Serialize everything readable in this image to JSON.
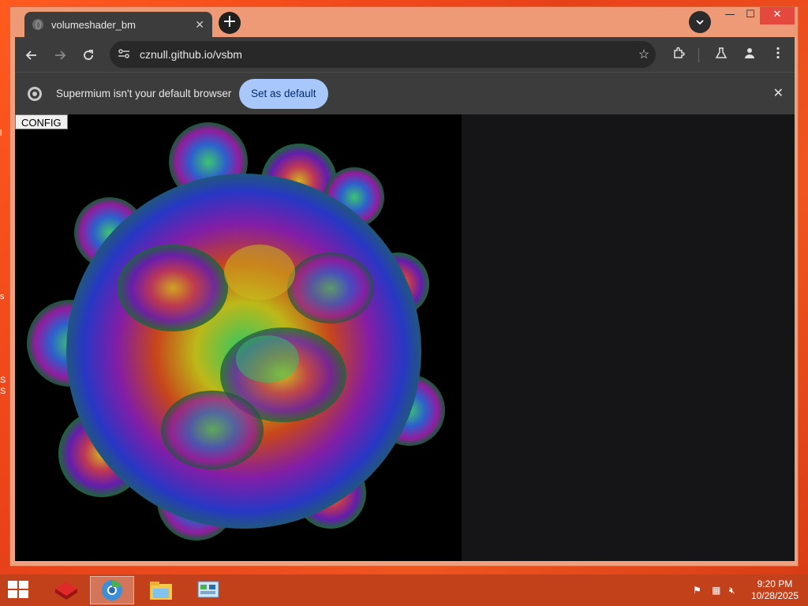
{
  "browser": {
    "tab_title": "volumeshader_bm",
    "tab_close": "✕",
    "new_tab": "+",
    "url": "cznull.github.io/vsbm",
    "window_controls": {
      "minimize": "—",
      "maximize": "☐",
      "close": "✕"
    }
  },
  "infobar": {
    "message": "Supermium isn't your default browser",
    "set_default_label": "Set as default",
    "close": "✕"
  },
  "page": {
    "config_button": "CONFIG"
  },
  "taskbar": {
    "time": "9:20 PM",
    "date": "10/28/2025",
    "apps": [
      "app-red-icon",
      "browser-icon",
      "file-explorer-icon",
      "control-panel-icon"
    ]
  },
  "desktop": {
    "edge_glyphs": [
      "s",
      "S",
      "S",
      "l"
    ]
  },
  "colors": {
    "desktop_bg": "#e8411a",
    "taskbar": "#c2411a",
    "window_frame": "#f0a07c",
    "toolbar": "#3c3c3c",
    "set_default_bg": "#a8c7fa"
  }
}
